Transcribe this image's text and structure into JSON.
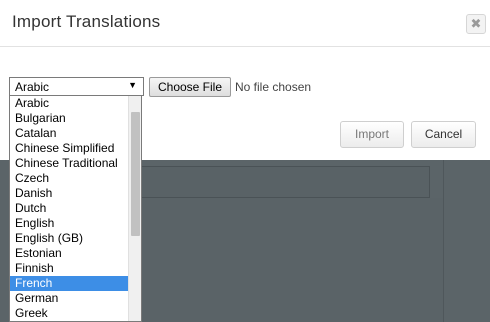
{
  "dialog": {
    "title": "Import Translations",
    "close_label": "✖"
  },
  "language_select": {
    "selected": "Arabic",
    "arrow": "▼",
    "options": [
      "Arabic",
      "Bulgarian",
      "Catalan",
      "Chinese Simplified",
      "Chinese Traditional",
      "Czech",
      "Danish",
      "Dutch",
      "English",
      "English (GB)",
      "Estonian",
      "Finnish",
      "French",
      "German",
      "Greek"
    ],
    "highlighted_option": "French"
  },
  "file_input": {
    "button_label": "Choose File",
    "status": "No file chosen"
  },
  "footer": {
    "import_label": "Import",
    "cancel_label": "Cancel"
  },
  "colors": {
    "highlight": "#3d8ee6",
    "backdrop": "#5b6468"
  }
}
